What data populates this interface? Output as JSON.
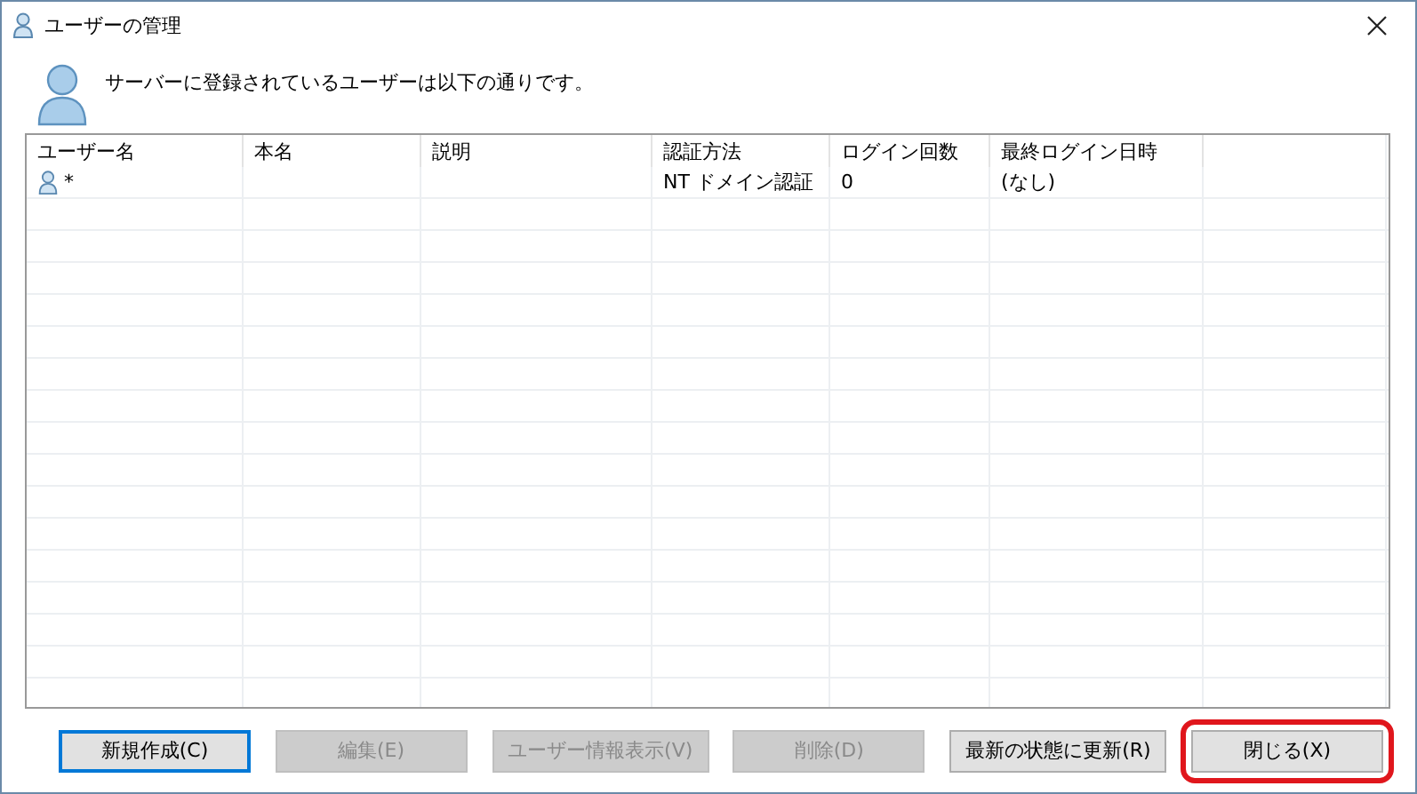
{
  "window": {
    "title": "ユーザーの管理"
  },
  "message": "サーバーに登録されているユーザーは以下の通りです。",
  "table": {
    "columns": [
      "ユーザー名",
      "本名",
      "説明",
      "認証方法",
      "ログイン回数",
      "最終ログイン日時"
    ],
    "rows": [
      {
        "cells": [
          "*",
          "",
          "",
          "NT ドメイン認証",
          "0",
          "(なし)"
        ]
      }
    ]
  },
  "buttons": [
    {
      "label": "新規作成(C)",
      "disabled": false,
      "default": true,
      "highlighted": false
    },
    {
      "label": "編集(E)",
      "disabled": true,
      "default": false,
      "highlighted": false
    },
    {
      "label": "ユーザー情報表示(V)",
      "disabled": true,
      "default": false,
      "highlighted": false
    },
    {
      "label": "削除(D)",
      "disabled": true,
      "default": false,
      "highlighted": false
    },
    {
      "label": "最新の状態に更新(R)",
      "disabled": false,
      "default": false,
      "highlighted": false
    },
    {
      "label": "閉じる(X)",
      "disabled": false,
      "default": false,
      "highlighted": true
    }
  ]
}
